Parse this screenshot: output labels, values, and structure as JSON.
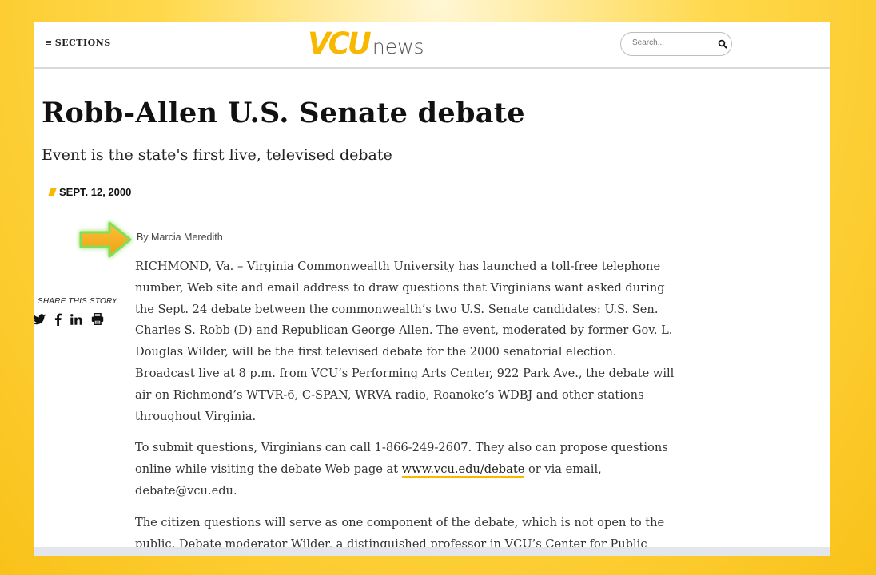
{
  "header": {
    "sections_label": "SECTIONS",
    "logo_primary": "VCU",
    "logo_secondary": "news",
    "search_placeholder": "Search..."
  },
  "article": {
    "title": "Robb-Allen U.S. Senate debate",
    "subtitle": "Event is the state's first live, televised debate",
    "date": "SEPT. 12, 2000",
    "byline": "By Marcia Meredith",
    "paragraphs": [
      "RICHMOND, Va. – Virginia Commonwealth University has launched a toll-free telephone number, Web site and email address to draw questions that Virginians want asked during the Sept. 24 debate between the commonwealth’s two U.S. Senate candidates: U.S. Sen. Charles S. Robb (D) and Republican George Allen. The event, moderated by former Gov. L. Douglas Wilder, will be the first televised debate for the 2000 senatorial election. Broadcast live at 8 p.m. from VCU’s Performing Arts Center, 922 Park Ave., the debate will air on Richmond’s WTVR-6, C-SPAN, WRVA radio, Roanoke’s WDBJ and other stations throughout Virginia."
    ],
    "p2_before": "To submit questions, Virginians can call 1-866-249-2607. They also can propose questions online while visiting the debate Web page at ",
    "p2_link": "www.vcu.edu/debate",
    "p2_after": " or via email, debate@vcu.edu.",
    "p3": "The citizen questions will serve as one component of the debate, which is not open to the public. Debate moderator Wilder, a distinguished professor in VCU’s Center for Public"
  },
  "share": {
    "label": "SHARE THIS STORY",
    "icons": [
      "twitter-icon",
      "facebook-icon",
      "linkedin-icon",
      "print-icon"
    ]
  },
  "colors": {
    "brand_gold": "#f8b800",
    "background_gold": "#ffd84a",
    "arrow_highlight": "#f5a623"
  }
}
